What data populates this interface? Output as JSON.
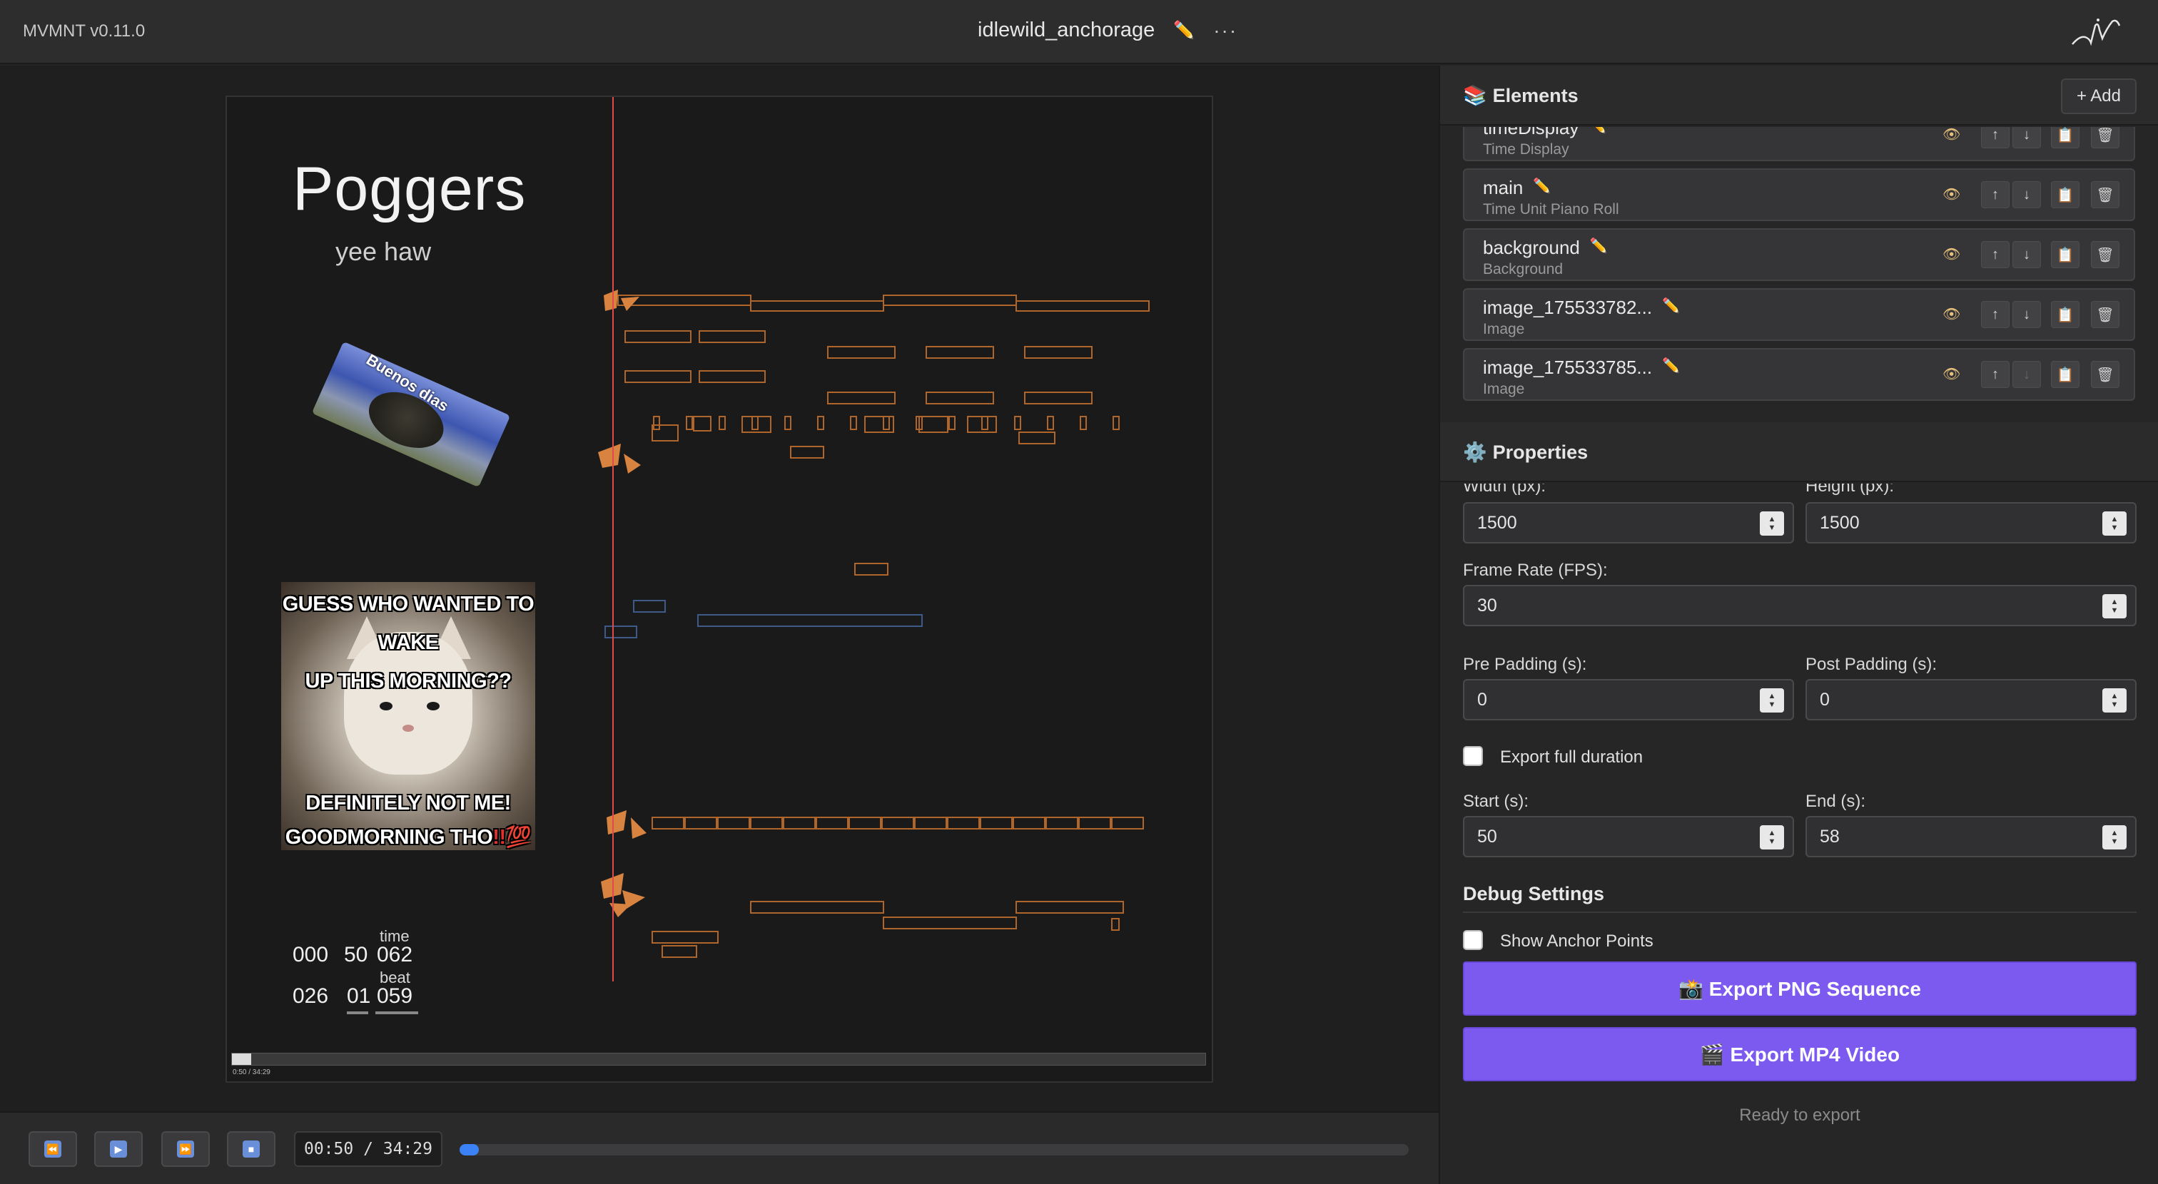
{
  "app": {
    "version": "MVMNT v0.11.0",
    "project_title": "idlewild_anchorage",
    "more_label": "···"
  },
  "stage": {
    "title": "Poggers",
    "subtitle": "yee haw",
    "sticker_text": "Buenos dias",
    "meme_top_1": "GUESS WHO WANTED TO WAKE",
    "meme_top_2": "UP THIS MORNING??",
    "meme_bottom_1": "DEFINITELY NOT ME!",
    "meme_bottom_2": "GOODMORNING THO",
    "meme_bang": "!!💯",
    "time_label": "time",
    "time_values": [
      "000",
      "50",
      "062"
    ],
    "beat_label": "beat",
    "beat_values": [
      "026",
      "01",
      "059"
    ],
    "scrub_progress": 0.02,
    "scrub_time": "0:50 / 34:29"
  },
  "transport": {
    "rewind_icon": "⏪",
    "play_icon": "▶",
    "forward_icon": "⏩",
    "stop_icon": "■",
    "time_readout": "00:50 / 34:29",
    "progress": 0.02
  },
  "elements": {
    "header": "Elements",
    "header_emoji": "📚",
    "add_label": "+ Add",
    "items": [
      {
        "name": "timeDisplay",
        "type": "Time Display",
        "down_enabled": true
      },
      {
        "name": "main",
        "type": "Time Unit Piano Roll",
        "down_enabled": true
      },
      {
        "name": "background",
        "type": "Background",
        "down_enabled": true
      },
      {
        "name": "image_175533782...",
        "type": "Image",
        "down_enabled": true
      },
      {
        "name": "image_175533785...",
        "type": "Image",
        "down_enabled": false
      }
    ],
    "pencil": "✏️",
    "eye": "👁",
    "up": "↑",
    "down": "↓",
    "copy": "📋",
    "delete": "🗑"
  },
  "properties": {
    "header": "Properties",
    "header_emoji": "⚙️",
    "width_label": "Width (px):",
    "height_label": "Height (px):",
    "width_value": "1500",
    "height_value": "1500",
    "fps_label": "Frame Rate (FPS):",
    "fps_value": "30",
    "pre_padding_label": "Pre Padding (s):",
    "pre_padding_value": "0",
    "post_padding_label": "Post Padding (s):",
    "post_padding_value": "0",
    "export_full_label": "Export full duration",
    "start_label": "Start (s):",
    "start_value": "50",
    "end_label": "End (s):",
    "end_value": "58",
    "debug_title": "Debug Settings",
    "anchor_label": "Show Anchor Points",
    "export_png": "📸 Export PNG Sequence",
    "export_mp4": "🎬 Export MP4 Video",
    "status": "Ready to export"
  }
}
